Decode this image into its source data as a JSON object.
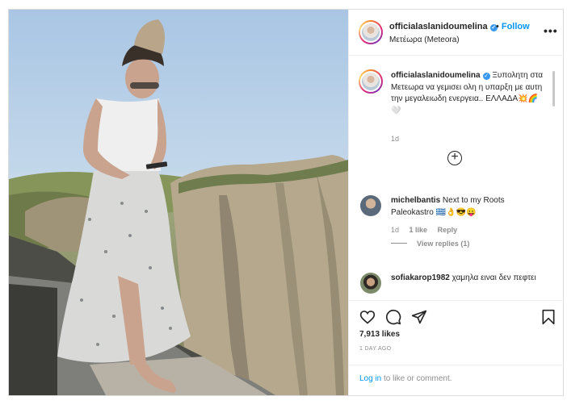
{
  "post": {
    "username": "officialaslanidoumelina",
    "follow_label": "Follow",
    "location": "Μετέωρα (Meteora)",
    "more_label": "•••",
    "caption": "Ξυπολητη στα Μετεωρα να γεμισει ολη η υπαρξη με αυτη την μεγαλειωδη ενεργεια.. ΕΛΛΑΔΑ💥🌈🤍",
    "caption_time": "1d",
    "load_more_label": "+",
    "verified_icon": "verified-badge-icon"
  },
  "comments": [
    {
      "username": "michelbantis",
      "text": "Next to my Roots Paleokastro 🇬🇷👌😎😛",
      "time": "1d",
      "likes": "1 like",
      "reply_label": "Reply",
      "view_replies": "View replies (1)"
    },
    {
      "username": "sofiakarop1982",
      "text": "χαμηλα ειναι δεν πεφτει"
    }
  ],
  "actions": {
    "likes": "7,913 likes",
    "posted_ago": "1 DAY AGO",
    "icons": [
      "heart-icon",
      "comment-icon",
      "share-icon",
      "bookmark-icon"
    ]
  },
  "login": {
    "link_label": "Log in",
    "suffix": " to like or comment."
  },
  "colors": {
    "accent": "#0095f6",
    "text": "#262626",
    "muted": "#8e8e8e",
    "border": "#dbdbdb"
  }
}
